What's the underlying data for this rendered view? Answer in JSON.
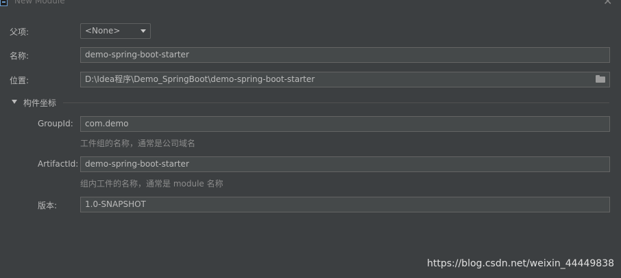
{
  "window": {
    "title": "New Module"
  },
  "form": {
    "parent": {
      "label": "父项:",
      "value": "<None>"
    },
    "name": {
      "label": "名称:",
      "value": "demo-spring-boot-starter"
    },
    "location": {
      "label": "位置:",
      "value": "D:\\Idea程序\\Demo_SpringBoot\\demo-spring-boot-starter"
    }
  },
  "section": {
    "title": "构件坐标",
    "group_id": {
      "label": "GroupId:",
      "value": "com.demo",
      "hint": "工件组的名称，通常是公司域名"
    },
    "artifact_id": {
      "label": "ArtifactId:",
      "value": "demo-spring-boot-starter",
      "hint": "组内工件的名称，通常是 module 名称"
    },
    "version": {
      "label": "版本:",
      "value": "1.0-SNAPSHOT"
    }
  },
  "watermark": "https://blog.csdn.net/weixin_44449838",
  "icons": {
    "app": "intellij-app-icon",
    "close": "close-icon",
    "browse": "folder-icon",
    "toggle": "triangle-down-icon"
  },
  "colors": {
    "background": "#3c3f41",
    "field": "#45494a",
    "text": "#bbbbbb",
    "hint": "#8c8c8c"
  }
}
